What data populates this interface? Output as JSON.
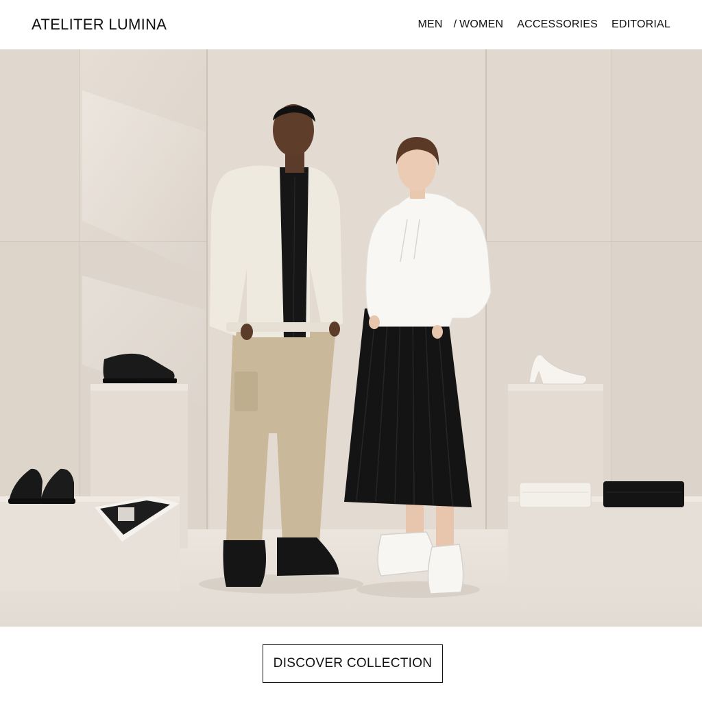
{
  "brand": {
    "name": "ATELITER LUMINA"
  },
  "nav": {
    "items": [
      {
        "label": "MEN"
      },
      {
        "label": "WOMEN"
      },
      {
        "label": "ACCESSORIES"
      },
      {
        "label": "EDITORIAL"
      }
    ],
    "separator": "/"
  },
  "hero": {
    "image_description_icon": "editorial-photo",
    "colors": {
      "wall": "#e3dbd2",
      "floor": "#e9e3dc",
      "plinth": "#e7e0d8"
    }
  },
  "cta": {
    "label": "DISCOVER COLLECTION"
  }
}
